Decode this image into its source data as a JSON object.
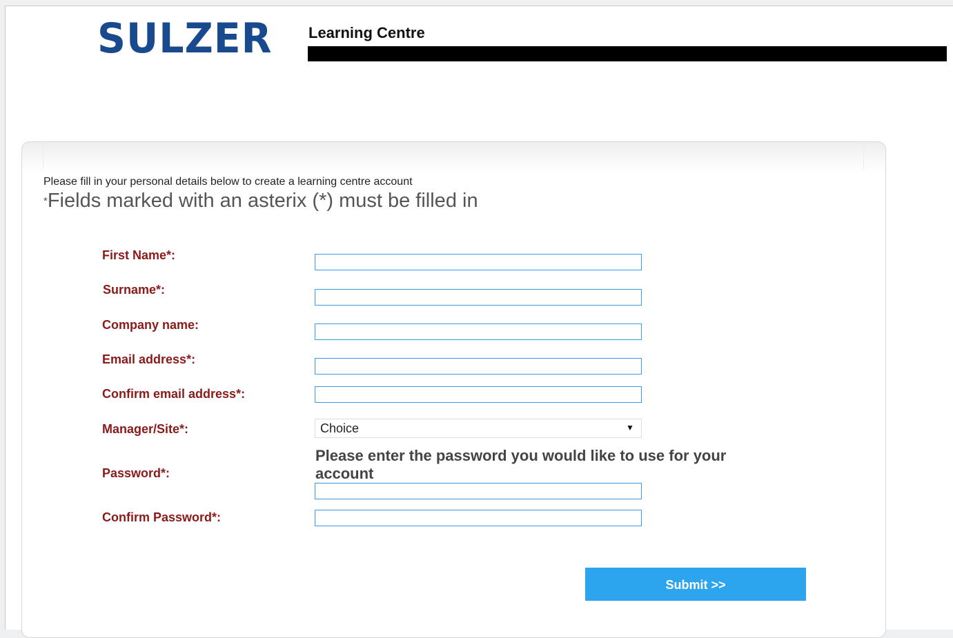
{
  "header": {
    "logo_text": "SULZER",
    "site_title": "Learning Centre"
  },
  "form": {
    "intro": "Please fill in your personal details below to create a learning centre account",
    "required_note_star": "*",
    "required_note": "Fields marked with an asterix (*) must be filled in",
    "fields": [
      {
        "label": "First Name*:",
        "value": ""
      },
      {
        "label": "Surname*:",
        "value": ""
      },
      {
        "label": "Company name:",
        "value": ""
      },
      {
        "label": "Email address*:",
        "value": ""
      },
      {
        "label": "Confirm email address*:",
        "value": ""
      }
    ],
    "manager_site": {
      "label": "Manager/Site*:",
      "selected": "Choice"
    },
    "password": {
      "label": "Password*:",
      "hint": "Please enter the password you would like to use for your account",
      "value": ""
    },
    "confirm_password": {
      "label": "Confirm Password*:",
      "value": ""
    },
    "submit_label": "Submit >>"
  },
  "colors": {
    "logo": "#1a4a8e",
    "label": "#8b1a1a",
    "input_border": "#3a9be6",
    "submit_bg": "#2da5ee"
  }
}
